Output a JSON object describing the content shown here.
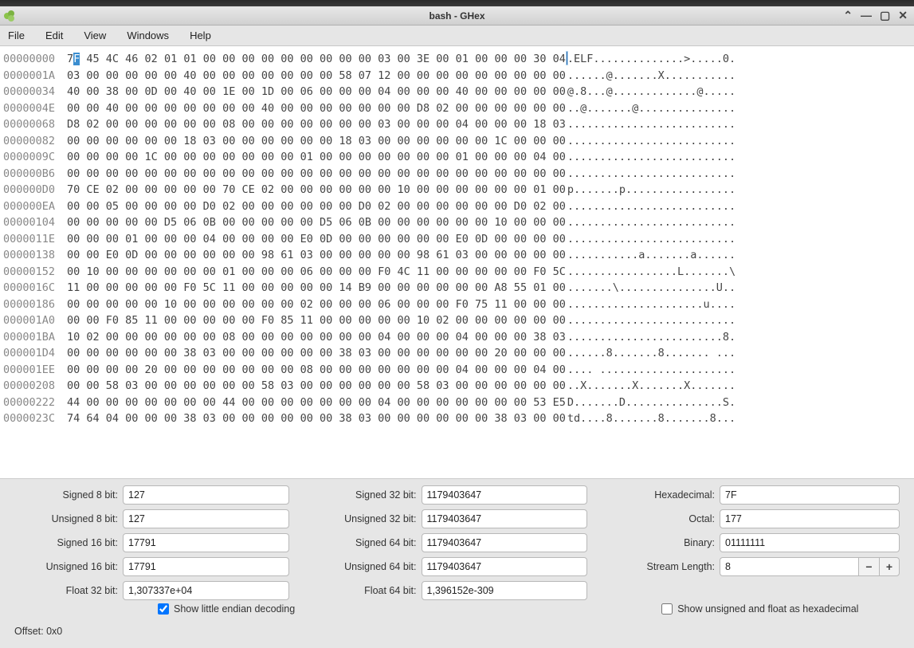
{
  "window": {
    "title": "bash - GHex"
  },
  "menu": {
    "file": "File",
    "edit": "Edit",
    "view": "View",
    "windows": "Windows",
    "help": "Help"
  },
  "hex": {
    "rows": [
      {
        "offset": "00000000",
        "first": "7",
        "selected": "F",
        "rest": " 45 4C 46 02 01 01 00 00 00 00 00 00 00 00 00 03 00 3E 00 01 00 00 00 30 04",
        "ascii": ".ELF..............>.....0."
      },
      {
        "offset": "0000001A",
        "hex": "03 00 00 00 00 00 40 00 00 00 00 00 00 00 58 07 12 00 00 00 00 00 00 00 00 00",
        "ascii": "......@.......X..........."
      },
      {
        "offset": "00000034",
        "hex": "40 00 38 00 0D 00 40 00 1E 00 1D 00 06 00 00 00 04 00 00 00 40 00 00 00 00 00",
        "ascii": "@.8...@.............@....."
      },
      {
        "offset": "0000004E",
        "hex": "00 00 40 00 00 00 00 00 00 00 40 00 00 00 00 00 00 00 D8 02 00 00 00 00 00 00",
        "ascii": "..@.......@..............."
      },
      {
        "offset": "00000068",
        "hex": "D8 02 00 00 00 00 00 00 08 00 00 00 00 00 00 00 03 00 00 00 04 00 00 00 18 03",
        "ascii": ".........................."
      },
      {
        "offset": "00000082",
        "hex": "00 00 00 00 00 00 18 03 00 00 00 00 00 00 18 03 00 00 00 00 00 00 1C 00 00 00",
        "ascii": ".........................."
      },
      {
        "offset": "0000009C",
        "hex": "00 00 00 00 1C 00 00 00 00 00 00 00 01 00 00 00 00 00 00 00 01 00 00 00 04 00",
        "ascii": ".........................."
      },
      {
        "offset": "000000B6",
        "hex": "00 00 00 00 00 00 00 00 00 00 00 00 00 00 00 00 00 00 00 00 00 00 00 00 00 00",
        "ascii": ".........................."
      },
      {
        "offset": "000000D0",
        "hex": "70 CE 02 00 00 00 00 00 70 CE 02 00 00 00 00 00 00 10 00 00 00 00 00 00 01 00",
        "ascii": "p.......p................."
      },
      {
        "offset": "000000EA",
        "hex": "00 00 05 00 00 00 00 D0 02 00 00 00 00 00 00 D0 02 00 00 00 00 00 00 D0 02 00",
        "ascii": ".........................."
      },
      {
        "offset": "00000104",
        "hex": "00 00 00 00 00 D5 06 0B 00 00 00 00 00 D5 06 0B 00 00 00 00 00 00 10 00 00 00",
        "ascii": ".........................."
      },
      {
        "offset": "0000011E",
        "hex": "00 00 00 01 00 00 00 04 00 00 00 00 E0 0D 00 00 00 00 00 00 E0 0D 00 00 00 00",
        "ascii": ".........................."
      },
      {
        "offset": "00000138",
        "hex": "00 00 E0 0D 00 00 00 00 00 00 98 61 03 00 00 00 00 00 98 61 03 00 00 00 00 00",
        "ascii": "...........a.......a......"
      },
      {
        "offset": "00000152",
        "hex": "00 10 00 00 00 00 00 00 01 00 00 00 06 00 00 00 F0 4C 11 00 00 00 00 00 F0 5C",
        "ascii": ".................L.......\\"
      },
      {
        "offset": "0000016C",
        "hex": "11 00 00 00 00 00 F0 5C 11 00 00 00 00 00 14 B9 00 00 00 00 00 00 A8 55 01 00",
        "ascii": ".......\\...............U.."
      },
      {
        "offset": "00000186",
        "hex": "00 00 00 00 00 10 00 00 00 00 00 00 02 00 00 00 06 00 00 00 F0 75 11 00 00 00",
        "ascii": ".....................u...."
      },
      {
        "offset": "000001A0",
        "hex": "00 00 F0 85 11 00 00 00 00 00 F0 85 11 00 00 00 00 00 10 02 00 00 00 00 00 00",
        "ascii": ".........................."
      },
      {
        "offset": "000001BA",
        "hex": "10 02 00 00 00 00 00 00 08 00 00 00 00 00 00 00 04 00 00 00 04 00 00 00 38 03",
        "ascii": "........................8."
      },
      {
        "offset": "000001D4",
        "hex": "00 00 00 00 00 00 38 03 00 00 00 00 00 00 38 03 00 00 00 00 00 00 20 00 00 00",
        "ascii": "......8.......8....... ..."
      },
      {
        "offset": "000001EE",
        "hex": "00 00 00 00 20 00 00 00 00 00 00 00 08 00 00 00 00 00 00 00 04 00 00 00 04 00",
        "ascii": ".... ....................."
      },
      {
        "offset": "00000208",
        "hex": "00 00 58 03 00 00 00 00 00 00 58 03 00 00 00 00 00 00 58 03 00 00 00 00 00 00",
        "ascii": "..X.......X.......X......."
      },
      {
        "offset": "00000222",
        "hex": "44 00 00 00 00 00 00 00 44 00 00 00 00 00 00 00 04 00 00 00 00 00 00 00 53 E5",
        "ascii": "D.......D...............S."
      },
      {
        "offset": "0000023C",
        "hex": "74 64 04 00 00 00 38 03 00 00 00 00 00 00 38 03 00 00 00 00 00 00 38 03 00 00",
        "ascii": "td....8.......8.......8..."
      }
    ]
  },
  "fields": {
    "s8_label": "Signed 8 bit:",
    "s8": "127",
    "u8_label": "Unsigned 8 bit:",
    "u8": "127",
    "s16_label": "Signed 16 bit:",
    "s16": "17791",
    "u16_label": "Unsigned 16 bit:",
    "u16": "17791",
    "f32_label": "Float 32 bit:",
    "f32": "1,307337e+04",
    "s32_label": "Signed 32 bit:",
    "s32": "1179403647",
    "u32_label": "Unsigned 32 bit:",
    "u32": "1179403647",
    "s64_label": "Signed 64 bit:",
    "s64": "1179403647",
    "u64_label": "Unsigned 64 bit:",
    "u64": "1179403647",
    "f64_label": "Float 64 bit:",
    "f64": "1,396152e-309",
    "hex_label": "Hexadecimal:",
    "hex": "7F",
    "oct_label": "Octal:",
    "oct": "177",
    "bin_label": "Binary:",
    "bin": "01111111",
    "slen_label": "Stream Length:",
    "slen": "8"
  },
  "checks": {
    "endian_label": "Show little endian decoding",
    "endian_checked": true,
    "hexmode_label": "Show unsigned and float as hexadecimal",
    "hexmode_checked": false
  },
  "status": {
    "offset": "Offset: 0x0"
  }
}
